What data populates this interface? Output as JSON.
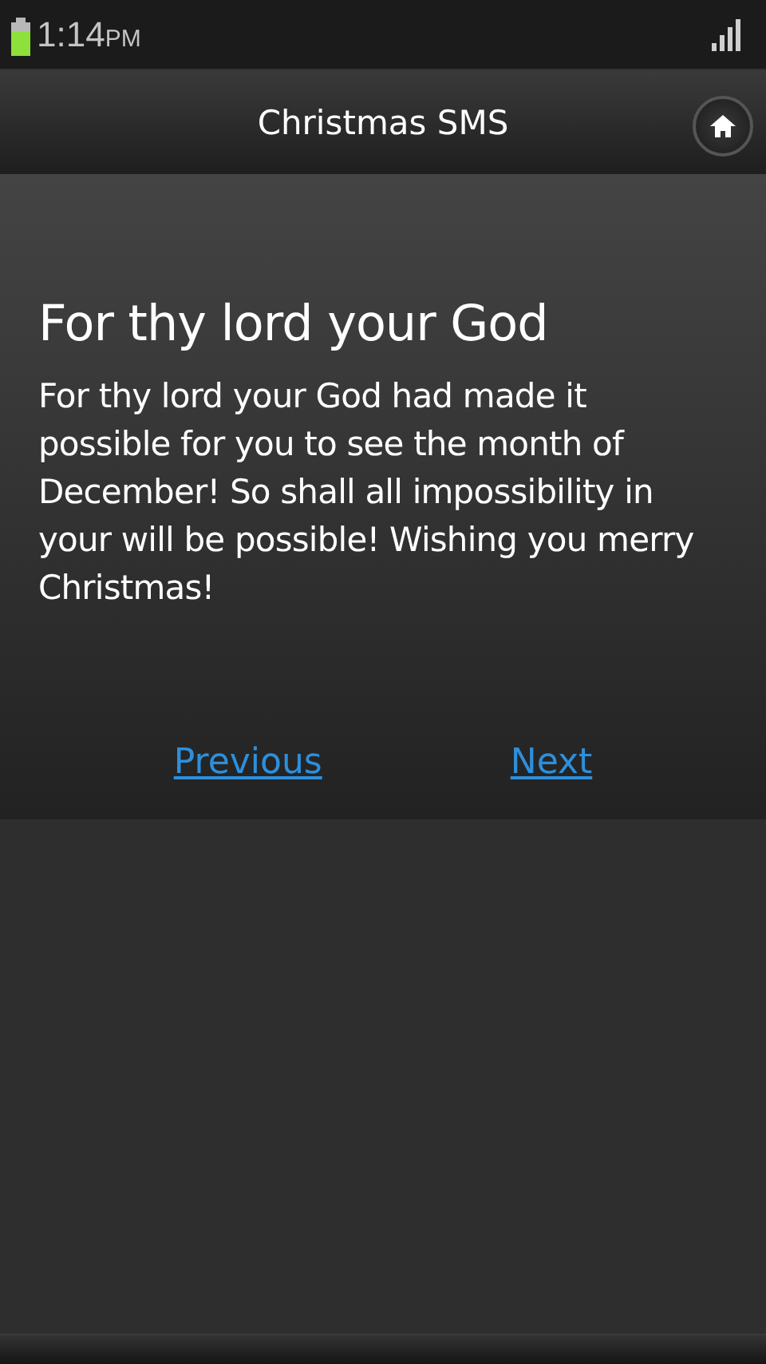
{
  "status_bar": {
    "time": "1:14",
    "period": "PM"
  },
  "header": {
    "title": "Christmas SMS"
  },
  "message": {
    "title": "For thy lord your God",
    "body": "For thy lord your God had made it possible for you to see the month of December! So shall all impossibility in your will be possible! Wishing you merry Christmas!"
  },
  "nav_links": [
    "Previous",
    "Next"
  ]
}
